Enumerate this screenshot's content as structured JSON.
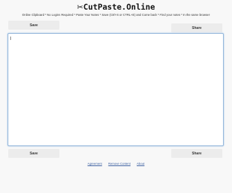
{
  "header": {
    "logo_icon": "scissors-icon",
    "logo_glyph": "✂",
    "logo_text": "CutPaste.Online",
    "tagline": "Online Clipboard * No Logins Required * Paste Your Notes * Save (Ctrl+S or CTRL+E) and Come back * Find your notes * In the same browser"
  },
  "toolbar_top": {
    "save_label": "Save",
    "share_label": "Share"
  },
  "editor": {
    "value": ""
  },
  "toolbar_bottom": {
    "save_label": "Save",
    "share_label": "Share"
  },
  "footer": {
    "links": [
      "Agreement",
      "Remove Content",
      "About"
    ]
  },
  "colors": {
    "background": "#f8f8f8",
    "button": "#ececec",
    "editor_border": "#8fb3d9",
    "link": "#3b5fa0"
  }
}
